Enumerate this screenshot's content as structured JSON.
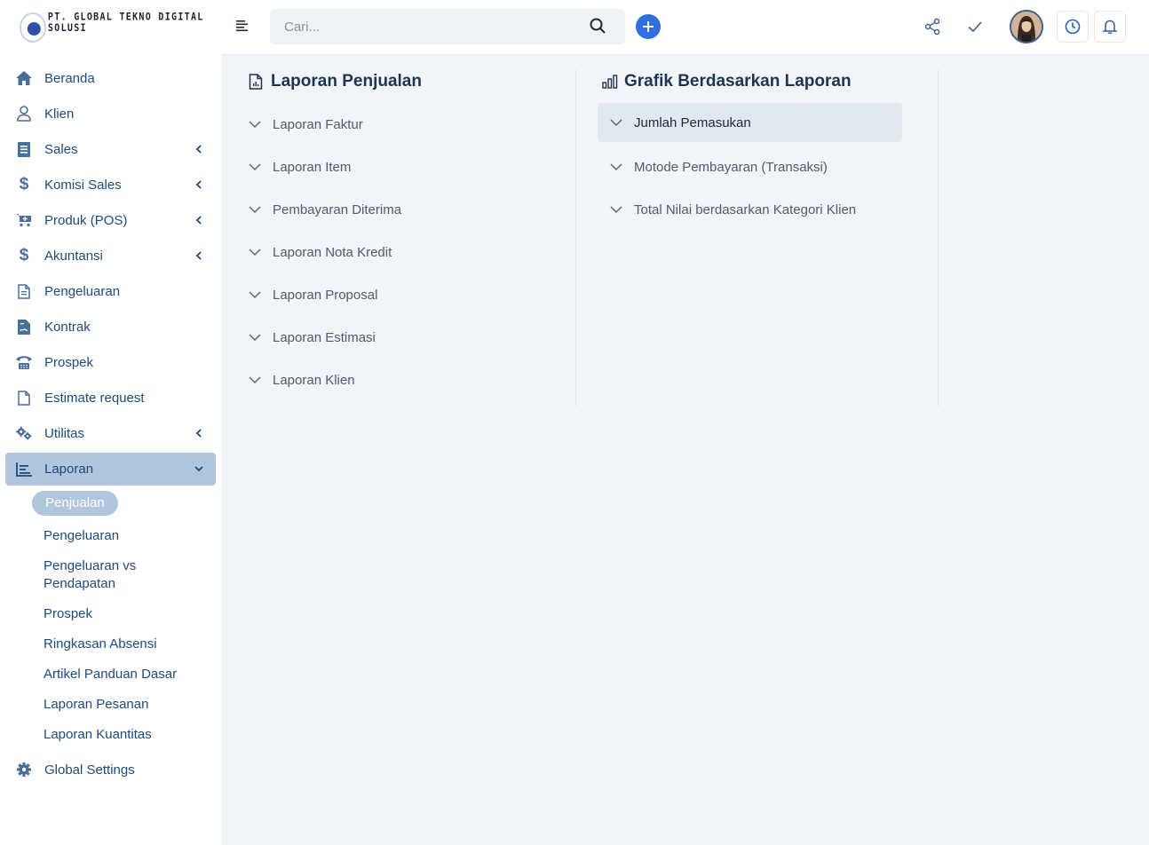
{
  "brand": {
    "name": "PT. GLOBAL TEKNO DIGITAL SOLUSI"
  },
  "search": {
    "placeholder": "Cari..."
  },
  "sidebar": {
    "items": [
      {
        "label": "Beranda",
        "icon": "home-icon"
      },
      {
        "label": "Klien",
        "icon": "user-icon"
      },
      {
        "label": "Sales",
        "icon": "receipt-icon",
        "expandable": true
      },
      {
        "label": "Komisi Sales",
        "icon": "dollar-icon",
        "expandable": true
      },
      {
        "label": "Produk (POS)",
        "icon": "cart-icon",
        "expandable": true
      },
      {
        "label": "Akuntansi",
        "icon": "dollar-icon",
        "expandable": true
      },
      {
        "label": "Pengeluaran",
        "icon": "file-icon"
      },
      {
        "label": "Kontrak",
        "icon": "contract-icon"
      },
      {
        "label": "Prospek",
        "icon": "phone-icon"
      },
      {
        "label": "Estimate request",
        "icon": "file-icon"
      },
      {
        "label": "Utilitas",
        "icon": "gears-icon",
        "expandable": true
      },
      {
        "label": "Laporan",
        "icon": "chart-icon",
        "expanded": true,
        "active": true
      }
    ],
    "laporan_sub": [
      {
        "label": "Penjualan",
        "active": true
      },
      {
        "label": "Pengeluaran"
      },
      {
        "label": "Pengeluaran vs",
        "label2": "Pendapatan"
      },
      {
        "label": "Prospek"
      },
      {
        "label": "Ringkasan Absensi"
      },
      {
        "label": "Artikel Panduan Dasar"
      },
      {
        "label": "Laporan Pesanan"
      },
      {
        "label": "Laporan Kuantitas"
      }
    ],
    "footer_item": {
      "label": "Global Settings",
      "icon": "gear-icon"
    }
  },
  "sales_reports": {
    "title": "Laporan Penjualan",
    "items": [
      "Laporan Faktur",
      "Laporan Item",
      "Pembayaran Diterima",
      "Laporan Nota Kredit",
      "Laporan Proposal",
      "Laporan Estimasi",
      "Laporan Klien"
    ]
  },
  "chart_reports": {
    "title": "Grafik Berdasarkan Laporan",
    "items": [
      {
        "label": "Jumlah Pemasukan",
        "selected": true
      },
      {
        "label": "Motode Pembayaran (Transaksi)"
      },
      {
        "label": "Total Nilai berdasarkan Kategori Klien"
      }
    ]
  },
  "colors": {
    "accent": "#2f6fe0",
    "sidebar_active": "#b0c6dc",
    "nav_text": "#1e4a7a",
    "content_bg": "#f1f4f9"
  }
}
